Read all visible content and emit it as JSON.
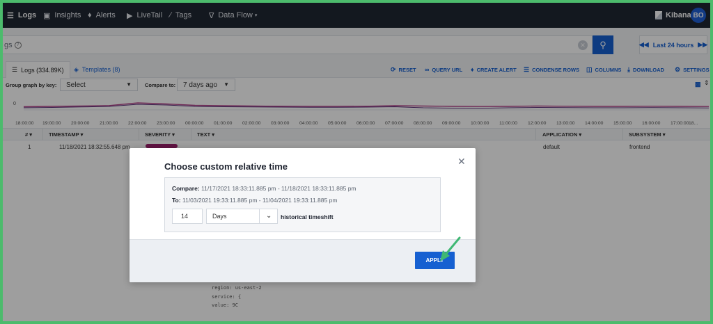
{
  "nav": {
    "items": [
      {
        "label": "Logs",
        "icon": "logs-icon"
      },
      {
        "label": "Insights",
        "icon": "insights-icon"
      },
      {
        "label": "Alerts",
        "icon": "bell-icon"
      },
      {
        "label": "LiveTail",
        "icon": "play-icon"
      },
      {
        "label": "Tags",
        "icon": "tags-icon"
      },
      {
        "label": "Data Flow",
        "icon": "data-flow-icon"
      }
    ],
    "kibana_label": "Kibana",
    "avatar_initials": "BO"
  },
  "search": {
    "partial_text": "gs",
    "help_icon": "help-icon",
    "time_range_label": "Last 24 hours"
  },
  "tabs": [
    {
      "label": "Logs (334.89K)",
      "active": true
    },
    {
      "label": "Templates (8)",
      "active": false
    }
  ],
  "actions": [
    {
      "label": "RESET",
      "icon": "reset-icon"
    },
    {
      "label": "QUERY URL",
      "icon": "link-icon"
    },
    {
      "label": "CREATE ALERT",
      "icon": "bell-icon"
    },
    {
      "label": "CONDENSE ROWS",
      "icon": "list-icon"
    },
    {
      "label": "COLUMNS",
      "icon": "columns-icon"
    },
    {
      "label": "DOWNLOAD",
      "icon": "download-icon"
    },
    {
      "label": "SETTINGS",
      "icon": "gear-icon"
    }
  ],
  "group_row": {
    "group_label": "Group graph by key:",
    "group_value": "Select",
    "compare_label": "Compare to:",
    "compare_value": "7 days ago"
  },
  "chart_data": {
    "type": "line",
    "x": [
      "18:00:00",
      "19:00:00",
      "20:00:00",
      "21:00:00",
      "22:00:00",
      "23:00:00",
      "00:00:00",
      "01:00:00",
      "02:00:00",
      "03:00:00",
      "04:00:00",
      "05:00:00",
      "06:00:00",
      "07:00:00",
      "08:00:00",
      "09:00:00",
      "10:00:00",
      "11:00:00",
      "12:00:00",
      "13:00:00",
      "14:00:00",
      "15:00:00",
      "16:00:00",
      "17:00:00",
      "18..."
    ],
    "y_tick": "0",
    "series": [
      {
        "values": [
          0.45,
          0.5,
          0.55,
          0.62,
          1.0,
          0.85,
          0.65,
          0.6,
          0.55,
          0.52,
          0.5,
          0.5,
          0.52,
          0.6,
          0.55,
          0.5,
          0.48,
          0.5,
          0.55,
          0.52,
          0.5,
          0.5,
          0.52,
          0.5,
          0.48
        ]
      },
      {
        "values": [
          0.3,
          0.35,
          0.42,
          0.5,
          0.8,
          0.7,
          0.5,
          0.45,
          0.42,
          0.4,
          0.38,
          0.38,
          0.4,
          0.45,
          0.3,
          0.25,
          0.22,
          0.3,
          0.35,
          0.33,
          0.3,
          0.3,
          0.33,
          0.3,
          0.28
        ]
      }
    ],
    "colors": [
      "#b5488d",
      "#5a2a78"
    ]
  },
  "table": {
    "headers": [
      "#",
      "TIMESTAMP",
      "SEVERITY",
      "TEXT",
      "APPLICATION",
      "SUBSYSTEM"
    ],
    "row": {
      "index": "1",
      "timestamp": "11/18/2021 18:32:55.648 pm",
      "application": "default",
      "subsystem": "frontend"
    },
    "code_lines": [
      "region: us-east-2",
      "service: {",
      "  value: 9C"
    ]
  },
  "modal": {
    "title": "Choose custom relative time",
    "compare_label": "Compare:",
    "compare_range": "11/17/2021 18:33:11.885 pm - 11/18/2021 18:33:11.885 pm",
    "to_label": "To:",
    "to_range": "11/03/2021 19:33:11.885 pm - 11/04/2021 19:33:11.885 pm",
    "amount": "14",
    "unit": "Days",
    "shift_label": "historical timeshift",
    "apply_label": "APPLY"
  },
  "colors": {
    "accent": "#1660d1",
    "nav_bg": "#1f2733",
    "frame": "#4cbb6c",
    "arrow": "#3fb873"
  }
}
